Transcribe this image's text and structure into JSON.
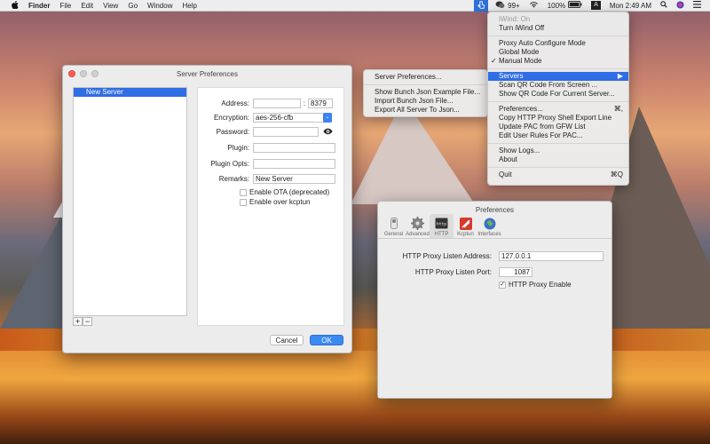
{
  "menubar": {
    "apple": "",
    "items": [
      "Finder",
      "File",
      "Edit",
      "View",
      "Go",
      "Window",
      "Help"
    ],
    "status": {
      "messages_count": "99+",
      "battery": "100%",
      "input_source": "A",
      "clock": "Mon 2:49 AM"
    }
  },
  "main_menu": {
    "status": "iWind: On",
    "turn_off": "Turn iWind Off",
    "modes": [
      "Proxy Auto Configure Mode",
      "Global Mode",
      "Manual Mode"
    ],
    "checked_mode": "Manual Mode",
    "servers": "Servers",
    "scan_qr": "Scan QR Code From Screen ...",
    "show_qr": "Show QR Code For Current Server...",
    "preferences": "Preferences...",
    "preferences_shortcut": "⌘,",
    "copy_http": "Copy HTTP Proxy Shell Export Line",
    "update_pac": "Update PAC from GFW List",
    "edit_rules": "Edit User Rules For PAC...",
    "show_logs": "Show Logs...",
    "about": "About",
    "quit": "Quit",
    "quit_shortcut": "⌘Q"
  },
  "servers_menu": {
    "server_prefs": "Server Preferences...",
    "show_bunch": "Show Bunch Json Example File...",
    "import_bunch": "Import Bunch Json File...",
    "export_all": "Export All Server To Json..."
  },
  "server_prefs": {
    "title": "Server Preferences",
    "servers": [
      "New Server"
    ],
    "address_label": "Address:",
    "address_value": "",
    "port_sep": ":",
    "port_value": "8379",
    "encryption_label": "Encryption:",
    "encryption_value": "aes-256-cfb",
    "password_label": "Password:",
    "password_value": "",
    "plugin_label": "Plugin:",
    "plugin_value": "",
    "plugin_opts_label": "Plugin Opts:",
    "plugin_opts_value": "",
    "remarks_label": "Remarks:",
    "remarks_value": "New Server",
    "ota_label": "Enable OTA (deprecated)",
    "kcptun_label": "Enable over kcptun",
    "cancel": "Cancel",
    "ok": "OK",
    "plus": "+",
    "minus": "−"
  },
  "prefs": {
    "title": "Preferences",
    "tabs": [
      "General",
      "Advanced",
      "HTTP",
      "Kcptun",
      "Interfaces"
    ],
    "active_tab": "HTTP",
    "listen_address_label": "HTTP Proxy Listen Address:",
    "listen_address_value": "127.0.0.1",
    "listen_port_label": "HTTP Proxy Listen Port:",
    "listen_port_value": "1087",
    "enable_label": "HTTP Proxy Enable"
  },
  "colors": {
    "accent": "#2f6ee5",
    "button_primary": "#3b8af3"
  }
}
